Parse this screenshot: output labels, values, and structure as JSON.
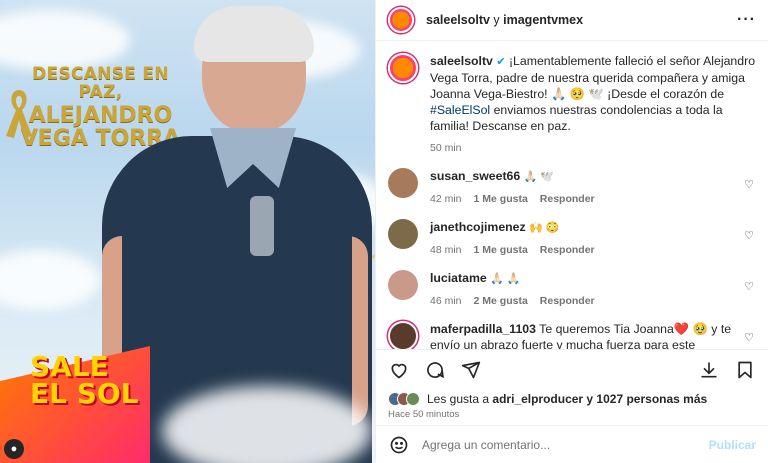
{
  "media": {
    "headline_line1": "DESCANSE EN PAZ,",
    "headline_line2": "ALEJANDRO",
    "headline_line3": "VEGA TORRA",
    "brand_line1": "SALE",
    "brand_line2": "EL SOL",
    "tag_icon": "user-icon"
  },
  "header": {
    "account": "saleelsoltv",
    "joiner": " y ",
    "collaborator": "imagentvmex",
    "more_label": "···"
  },
  "caption": {
    "user": "saleelsoltv",
    "text_part1": " ¡Lamentablemente falleció el señor Alejandro Vega Torra, padre de nuestra querida compañera y amiga Joanna Vega-Biestro! 🙏🏻 🥺 🕊️ ¡Desde el corazón de ",
    "hashtag": "#SaleElSol",
    "text_part2": " enviamos nuestras condolencias a toda la familia! Descanse en paz.",
    "time": "50 min"
  },
  "comments": [
    {
      "user": "susan_sweet66",
      "text": "🙏🏻 🕊️",
      "time": "42 min",
      "likes": "1 Me gusta",
      "reply": "Responder"
    },
    {
      "user": "janethcojimenez",
      "text": "🙌 😳",
      "time": "48 min",
      "likes": "1 Me gusta",
      "reply": "Responder"
    },
    {
      "user": "luciatame",
      "text": "🙏🏻 🙏🏻",
      "time": "46 min",
      "likes": "2 Me gusta",
      "reply": "Responder"
    },
    {
      "user": "maferpadilla_1103",
      "text": "Te queremos Tia Joanna❤️ 🥹 y te envío un abrazo fuerte y mucha fuerza para este momento 🥹 ❤️",
      "time": "",
      "likes": "",
      "reply": ""
    }
  ],
  "likes": {
    "prefix": "Les gusta a ",
    "user": "adri_elproducer",
    "suffix": " y 1027 personas más"
  },
  "posted_ago": "Hace 50 minutos",
  "add_comment": {
    "emoji_icon": "smiley-icon",
    "placeholder": "Agrega un comentario...",
    "publish": "Publicar"
  }
}
